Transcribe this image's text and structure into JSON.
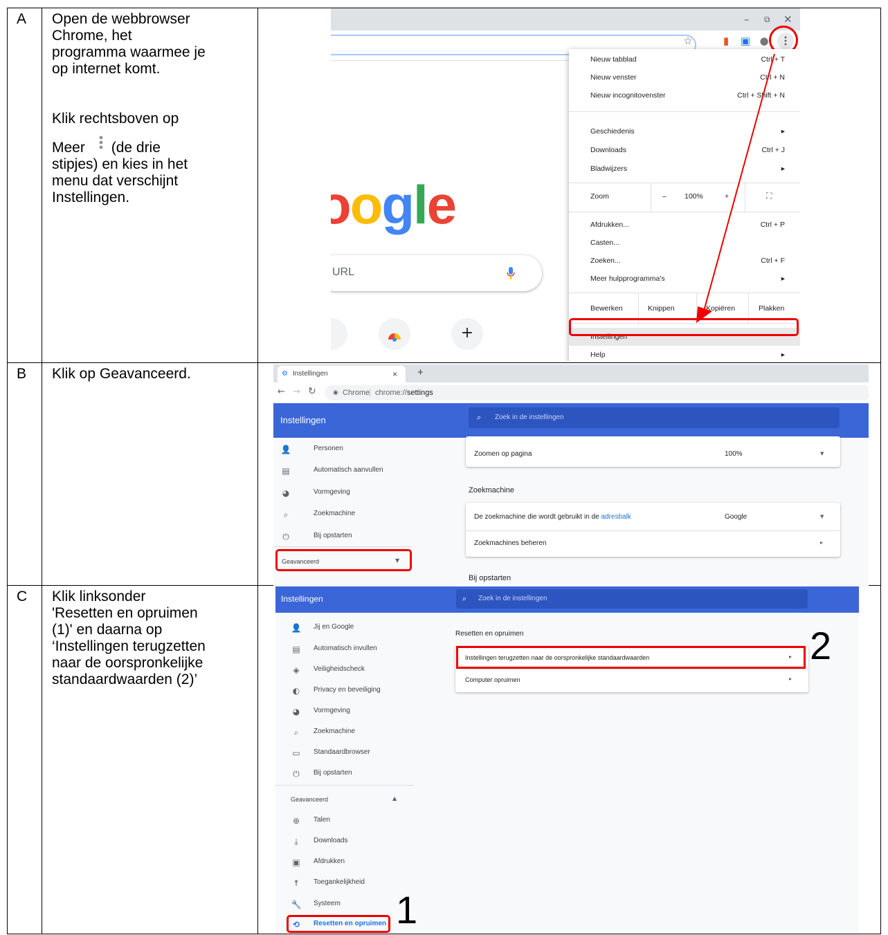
{
  "rows": [
    {
      "letter": "A",
      "instruction_lines": [
        "Open de webbrowser",
        "Chrome, het",
        "programma waarmee je",
        "op internet komt."
      ],
      "instruction_lines_2": [
        "Klik rechtsboven op",
        "Meer",
        "(de drie",
        "stipjes) en kies in het",
        "menu dat verschijnt",
        "Instellingen."
      ]
    },
    {
      "letter": "B",
      "instruction_lines": [
        "Klik op Geavanceerd."
      ]
    },
    {
      "letter": "C",
      "instruction_lines": [
        "Klik linksonder",
        "'Resetten en opruimen",
        "(1)' en daarna op",
        "‘Instellingen terugzetten",
        "naar de oorspronkelijke",
        "standaardwaarden (2)’"
      ]
    }
  ],
  "panel_a": {
    "window_controls": [
      "–",
      "⧉",
      "✕"
    ],
    "logo_letters": [
      "o",
      "o",
      "g",
      "l",
      "e"
    ],
    "logo_colors": [
      "#ea4335",
      "#fbbc05",
      "#4285f4",
      "#34a853",
      "#ea4335"
    ],
    "search_placeholder": "URL",
    "menu": {
      "items": [
        {
          "label": "Nieuw tabblad",
          "shortcut": "Ctrl + T"
        },
        {
          "label": "Nieuw venster",
          "shortcut": "Ctrl + N"
        },
        {
          "label": "Nieuw incognitovenster",
          "shortcut": "Ctrl + Shift + N"
        },
        {
          "label": "Geschiedenis",
          "shortcut": "▸"
        },
        {
          "label": "Downloads",
          "shortcut": "Ctrl + J"
        },
        {
          "label": "Bladwijzers",
          "shortcut": "▸"
        },
        {
          "label": "Afdrukken...",
          "shortcut": "Ctrl + P"
        },
        {
          "label": "Casten...",
          "shortcut": ""
        },
        {
          "label": "Zoeken...",
          "shortcut": "Ctrl + F"
        },
        {
          "label": "Meer hulpprogramma's",
          "shortcut": "▸"
        },
        {
          "label": "Instellingen",
          "shortcut": ""
        },
        {
          "label": "Help",
          "shortcut": "▸"
        }
      ],
      "zoom": {
        "label": "Zoom",
        "minus": "–",
        "value": "100%",
        "plus": "+",
        "fullscreen": "⛶"
      },
      "edit": {
        "label": "Bewerken",
        "cut": "Knippen",
        "copy": "Kopiëren",
        "paste": "Plakken"
      }
    }
  },
  "panel_b": {
    "tab_title": "Instellingen",
    "tab_close": "×",
    "tab_new": "+",
    "address_chip": "Chrome",
    "address_url_prefix": "chrome://",
    "address_url_bold": "settings",
    "header_title": "Instellingen",
    "search_placeholder": "Zoek in de instellingen",
    "nav": [
      "Personen",
      "Automatisch aanvullen",
      "Vormgeving",
      "Zoekmachine",
      "Bij opstarten"
    ],
    "advanced": "Geavanceerd",
    "zoom_label": "Zoomen op pagina",
    "zoom_value": "100%",
    "section_search": "Zoekmachine",
    "engine_label_prefix": "De zoekmachine die wordt gebruikt in de ",
    "engine_label_link": "adresbalk",
    "engine_value": "Google",
    "manage_engines": "Zoekmachines beheren",
    "section_startup": "Bij opstarten"
  },
  "panel_c": {
    "header_title": "Instellingen",
    "search_placeholder": "Zoek in de instellingen",
    "nav": [
      "Jij en Google",
      "Automatisch invullen",
      "Veiligheidscheck",
      "Privacy en beveiliging",
      "Vormgeving",
      "Zoekmachine",
      "Standaardbrowser",
      "Bij opstarten"
    ],
    "advanced": "Geavanceerd",
    "advanced_nav": [
      "Talen",
      "Downloads",
      "Afdrukken",
      "Toegankelijkheid",
      "Systeem",
      "Resetten en opruimen"
    ],
    "section_title": "Resetten en opruimen",
    "reset_row": "Instellingen terugzetten naar de oorspronkelijke standaardwaarden",
    "cleanup_row": "Computer opruimen",
    "marker_1": "1",
    "marker_2": "2"
  }
}
